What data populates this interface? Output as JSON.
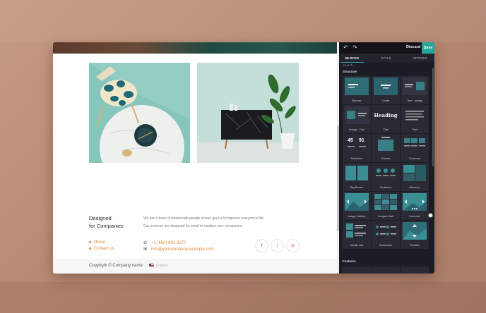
{
  "editor": {
    "undo_icon": "undo-icon",
    "redo_icon": "redo-icon",
    "discard_label": "Discard",
    "save_label": "Save",
    "tabs": [
      {
        "label": "BLOCKS",
        "active": true
      },
      {
        "label": "STYLE",
        "active": false
      },
      {
        "label": "OPTIONS",
        "active": false
      }
    ],
    "search_placeholder": "Search...",
    "categories": [
      "Structure",
      "Features"
    ],
    "blocks": [
      "Banner",
      "Cover",
      "Text - Image",
      "Image - Text",
      "Title",
      "Text",
      "Numbers",
      "Picture",
      "Columns",
      "Big Boxes",
      "Features",
      "Masonry",
      "Image Gallery",
      "Images Wall",
      "Carousel",
      "Media List",
      "Showcase",
      "Parallax"
    ],
    "title_thumb_text": "Heading",
    "numbers_thumb": [
      "45",
      "91"
    ],
    "accent_color": "#26a69a"
  },
  "site": {
    "footer": {
      "title_line1": "Designed",
      "title_line2": "for Companies",
      "desc_line1": "We are a team of passionate people whose goal is to improve everyone's life.",
      "desc_line2": "Our services are designed for small to medium size companies.",
      "links": [
        "Home",
        "Contact us"
      ],
      "phone": "+1 (650) 691-3277",
      "email": "info@yourcompany.example.com",
      "social": [
        "facebook-icon",
        "twitter-icon",
        "instagram-icon"
      ],
      "link_color": "#e08a3a"
    },
    "copyright": "Copyright © Company name",
    "language": "English"
  }
}
